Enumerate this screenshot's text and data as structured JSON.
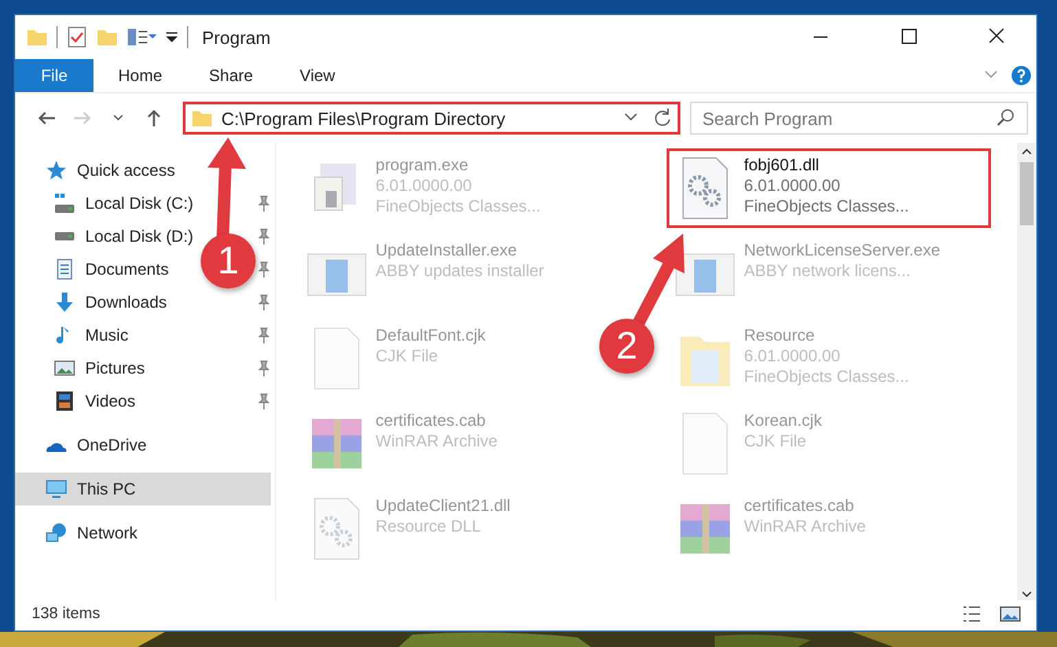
{
  "window": {
    "title": "Program"
  },
  "ribbon_tabs": [
    {
      "label": "File",
      "selected": true
    },
    {
      "label": "Home",
      "selected": false
    },
    {
      "label": "Share",
      "selected": false
    },
    {
      "label": "View",
      "selected": false
    }
  ],
  "address": {
    "value": "C:\\Program Files\\Program Directory",
    "highlighted": true
  },
  "search": {
    "placeholder": "Search Program"
  },
  "sidebar": {
    "items": [
      {
        "label": "Quick access",
        "kind": "star",
        "selected": false,
        "children": [
          {
            "label": "Local Disk (C:)",
            "kind": "windisk",
            "pinned": true,
            "selected": false
          },
          {
            "label": "Local Disk (D:)",
            "kind": "disk",
            "pinned": true,
            "selected": false
          },
          {
            "label": "Documents",
            "kind": "document",
            "pinned": true,
            "selected": false
          },
          {
            "label": "Downloads",
            "kind": "download",
            "pinned": true,
            "selected": false
          },
          {
            "label": "Music",
            "kind": "music",
            "pinned": true,
            "selected": false
          },
          {
            "label": "Pictures",
            "kind": "pictures",
            "pinned": true,
            "selected": false
          },
          {
            "label": "Videos",
            "kind": "video",
            "pinned": true,
            "selected": false
          }
        ]
      },
      {
        "label": "OneDrive",
        "kind": "cloud",
        "selected": false
      },
      {
        "label": "This PC",
        "kind": "computer",
        "selected": true
      },
      {
        "label": "Network",
        "kind": "network",
        "selected": false
      }
    ]
  },
  "files": [
    {
      "name": "program.exe",
      "lines": [
        "6.01.0000.00",
        "FineObjects Classes..."
      ],
      "kind": "app",
      "highlighted": false
    },
    {
      "name": "fobj601.dll",
      "lines": [
        "6.01.0000.00",
        "FineObjects Classes..."
      ],
      "kind": "dll",
      "highlighted": true
    },
    {
      "name": "UpdateInstaller.exe",
      "lines": [
        "ABBY updates installer"
      ],
      "kind": "installer",
      "highlighted": false
    },
    {
      "name": "NetworkLicenseServer.exe",
      "lines": [
        "ABBY network licens..."
      ],
      "kind": "installer",
      "highlighted": false
    },
    {
      "name": "DefaultFont.cjk",
      "lines": [
        "CJK File"
      ],
      "kind": "blank",
      "highlighted": false
    },
    {
      "name": "Resource",
      "lines": [
        "6.01.0000.00",
        "FineObjects Classes..."
      ],
      "kind": "folder",
      "highlighted": false
    },
    {
      "name": "certificates.cab",
      "lines": [
        "WinRAR Archive"
      ],
      "kind": "archive",
      "highlighted": false
    },
    {
      "name": "Korean.cjk",
      "lines": [
        "CJK File"
      ],
      "kind": "blank",
      "highlighted": false
    },
    {
      "name": "UpdateClient21.dll",
      "lines": [
        "Resource DLL"
      ],
      "kind": "dll",
      "highlighted": false
    },
    {
      "name": "certificates.cab",
      "lines": [
        "WinRAR Archive"
      ],
      "kind": "archive",
      "highlighted": false
    }
  ],
  "status_bar": {
    "item_count": "138 items"
  },
  "annotations": [
    {
      "number": "1"
    },
    {
      "number": "2"
    }
  ]
}
